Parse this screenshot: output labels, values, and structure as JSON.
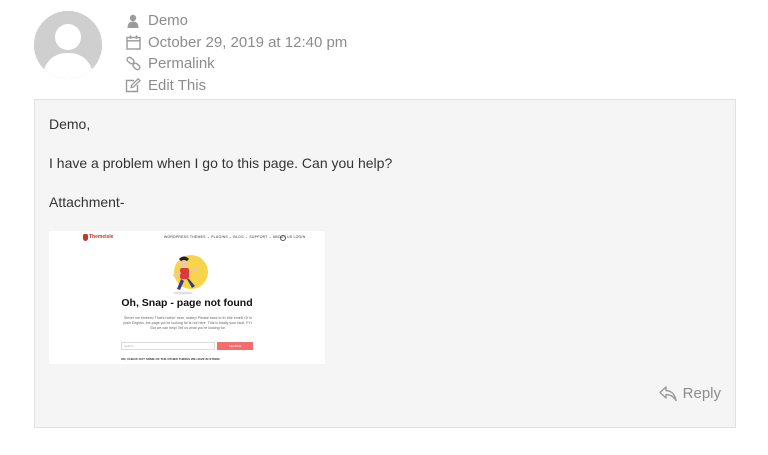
{
  "comment": {
    "author": "Demo",
    "date": "October 29, 2019 at 12:40 pm",
    "permalink_label": "Permalink",
    "edit_label": "Edit This",
    "body": {
      "greeting": "Demo,",
      "message": "I have a problem when I go to this page. Can you help?",
      "attachment_label": "Attachment-"
    },
    "reply_label": "Reply"
  },
  "attachment": {
    "logo_text": "Themeisle",
    "menu_text": "WORDPRESS THEMES ⌄   PLUGINS ⌄   BLOG ⌄   SUPPORT ⌄   ABOUT US   LOGIN",
    "title": "Oh, Snap - page not found",
    "paragraph": "Shiver me timbers! That's nothin' here, matey! Please back to th' title emini! Or in plain English, the page you're looking for is not here. This is totally your fault. FYI. But we can help! Tell us what you're looking for.",
    "search_placeholder": "Search ...",
    "search_button": "SEARCH",
    "footer_text": "OR, CHECK OUT SOME OF THE OTHER THINGS WE HAVE IN STORE:"
  },
  "icons": {
    "author": "user-icon",
    "date": "calendar-icon",
    "permalink": "link-icon",
    "edit": "edit-icon",
    "reply": "reply-icon"
  },
  "colors": {
    "meta_text": "#8c8c8c",
    "box_bg": "#f5f5f5",
    "avatar_bg": "#cfcfcf",
    "accent_button": "#f26d6d"
  }
}
